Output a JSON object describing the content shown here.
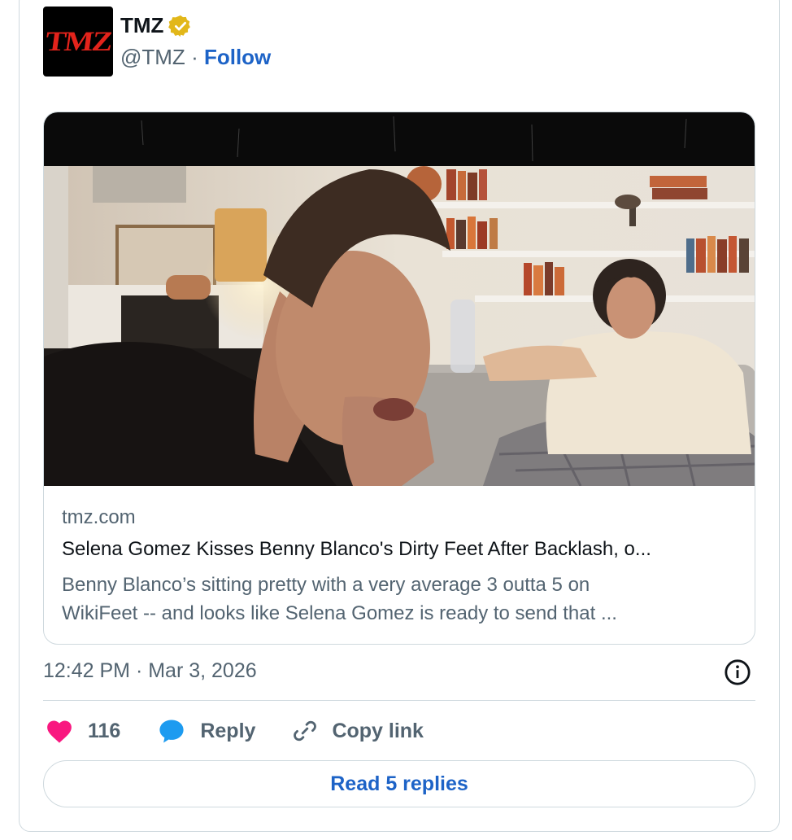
{
  "author": {
    "name": "TMZ",
    "handle": "@TMZ",
    "separator": "·",
    "follow_label": "Follow",
    "avatar_text": "TMZ"
  },
  "card": {
    "domain": "tmz.com",
    "title": "Selena Gomez Kisses Benny Blanco's Dirty Feet After Backlash, o...",
    "description_line1": "Benny Blanco’s sitting pretty with a very average 3 outta 5 on",
    "description_line2": "WikiFeet -- and looks like Selena Gomez is ready to send that ..."
  },
  "timestamp": "12:42 PM · Mar 3, 2026",
  "actions": {
    "like_count": "116",
    "reply_label": "Reply",
    "copy_link_label": "Copy link"
  },
  "read_replies_label": "Read 5 replies",
  "colors": {
    "accent": "#1d63c7",
    "like": "#f91880",
    "reply_bubble": "#1d9bf0",
    "verified": "#e2b719",
    "muted_text": "#536471",
    "border": "#cfd9de"
  }
}
